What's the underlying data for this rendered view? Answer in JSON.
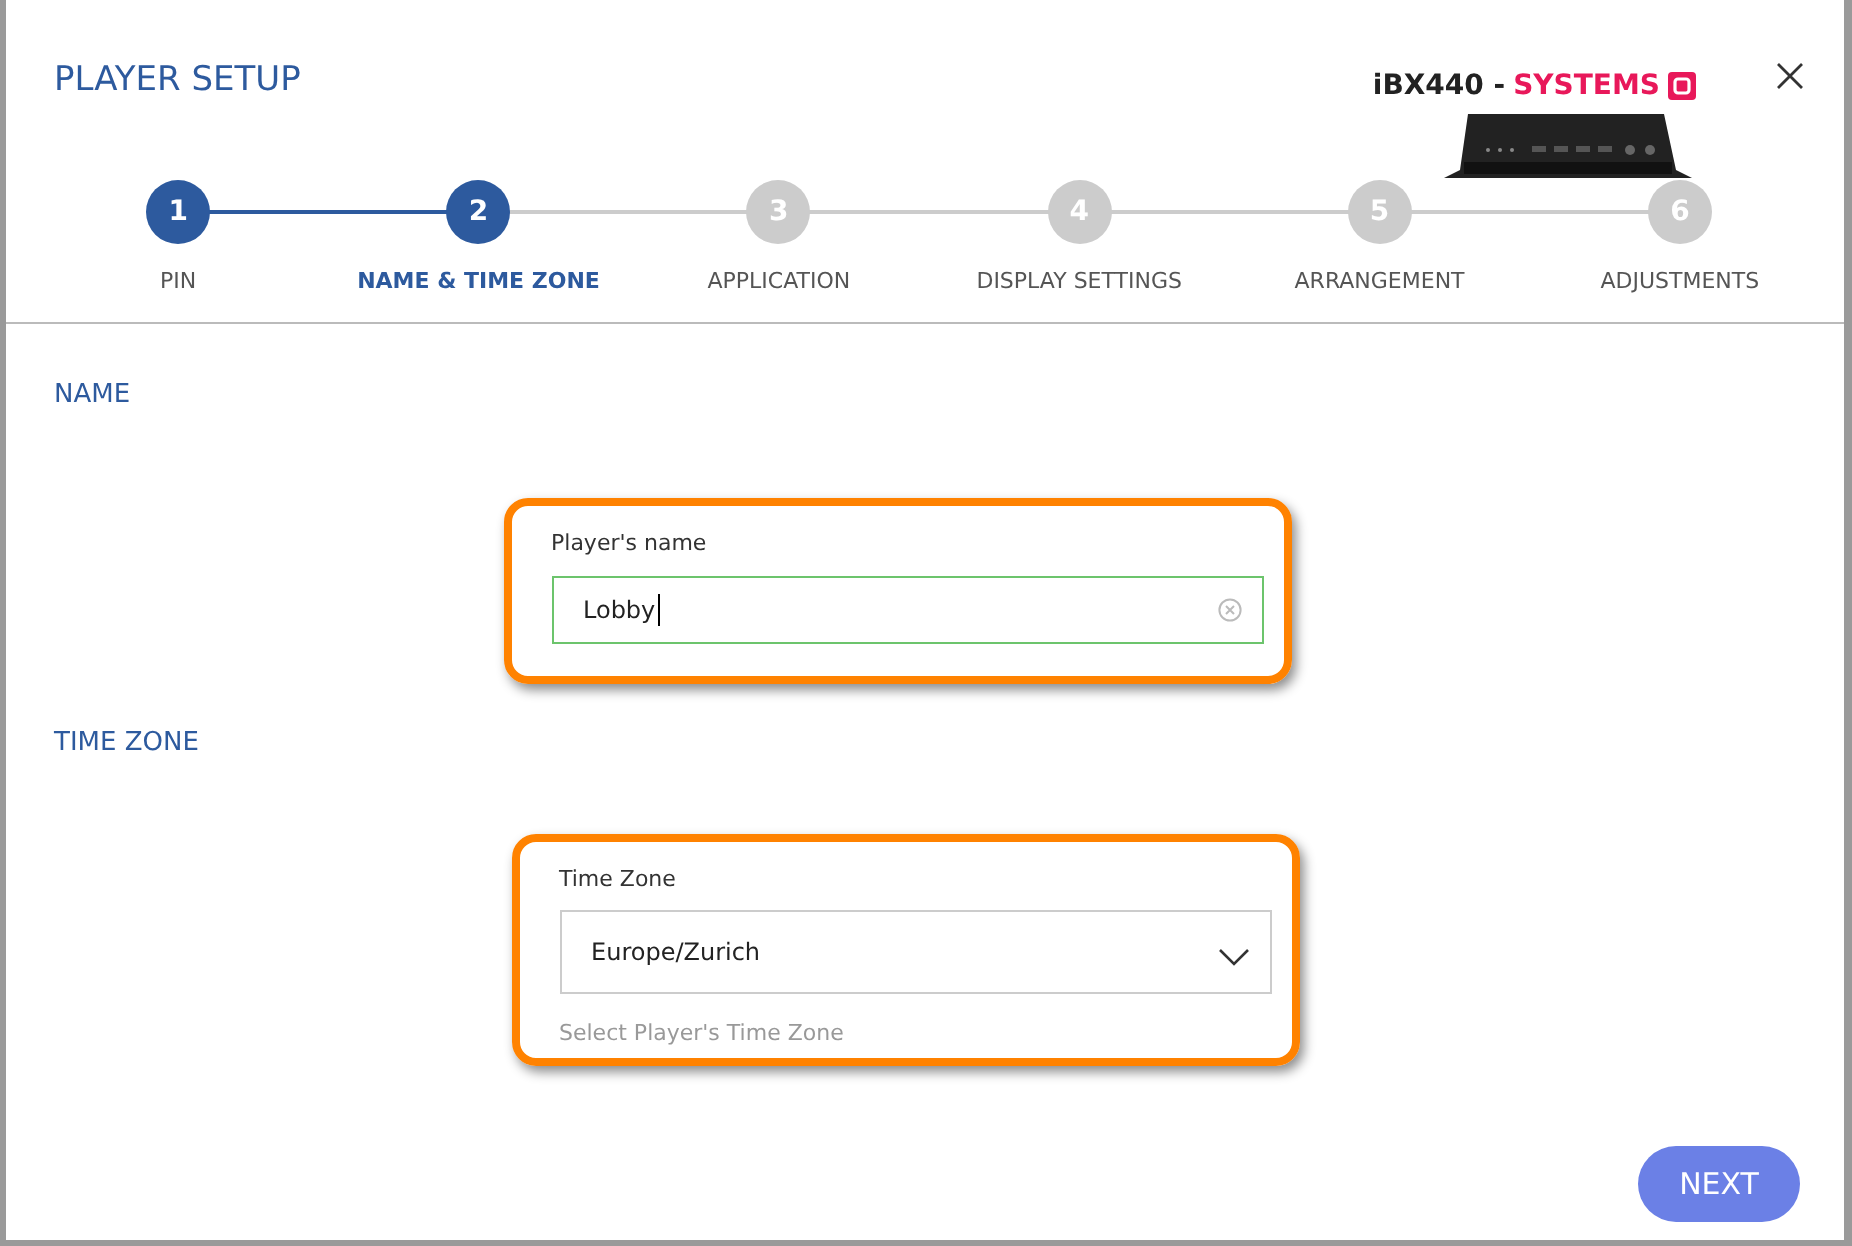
{
  "window": {
    "title": "PLAYER SETUP"
  },
  "product": {
    "model": "iBX440 -",
    "brand": "SYSTEMS"
  },
  "steps": [
    {
      "number": "1",
      "label": "PIN",
      "completed": true,
      "selected": false
    },
    {
      "number": "2",
      "label": "NAME & TIME ZONE",
      "completed": true,
      "selected": true
    },
    {
      "number": "3",
      "label": "APPLICATION",
      "completed": false,
      "selected": false
    },
    {
      "number": "4",
      "label": "DISPLAY SETTINGS",
      "completed": false,
      "selected": false
    },
    {
      "number": "5",
      "label": "ARRANGEMENT",
      "completed": false,
      "selected": false
    },
    {
      "number": "6",
      "label": "ADJUSTMENTS",
      "completed": false,
      "selected": false
    }
  ],
  "name_section": {
    "heading": "NAME",
    "label": "Player's name",
    "value": "Lobby",
    "highlighted": true
  },
  "time_zone_section": {
    "heading": "TIME ZONE",
    "label": "Time Zone",
    "value": "Europe/Zurich",
    "hint": "Select Player's Time Zone",
    "highlighted": true
  },
  "buttons": [
    "NEXT"
  ]
}
